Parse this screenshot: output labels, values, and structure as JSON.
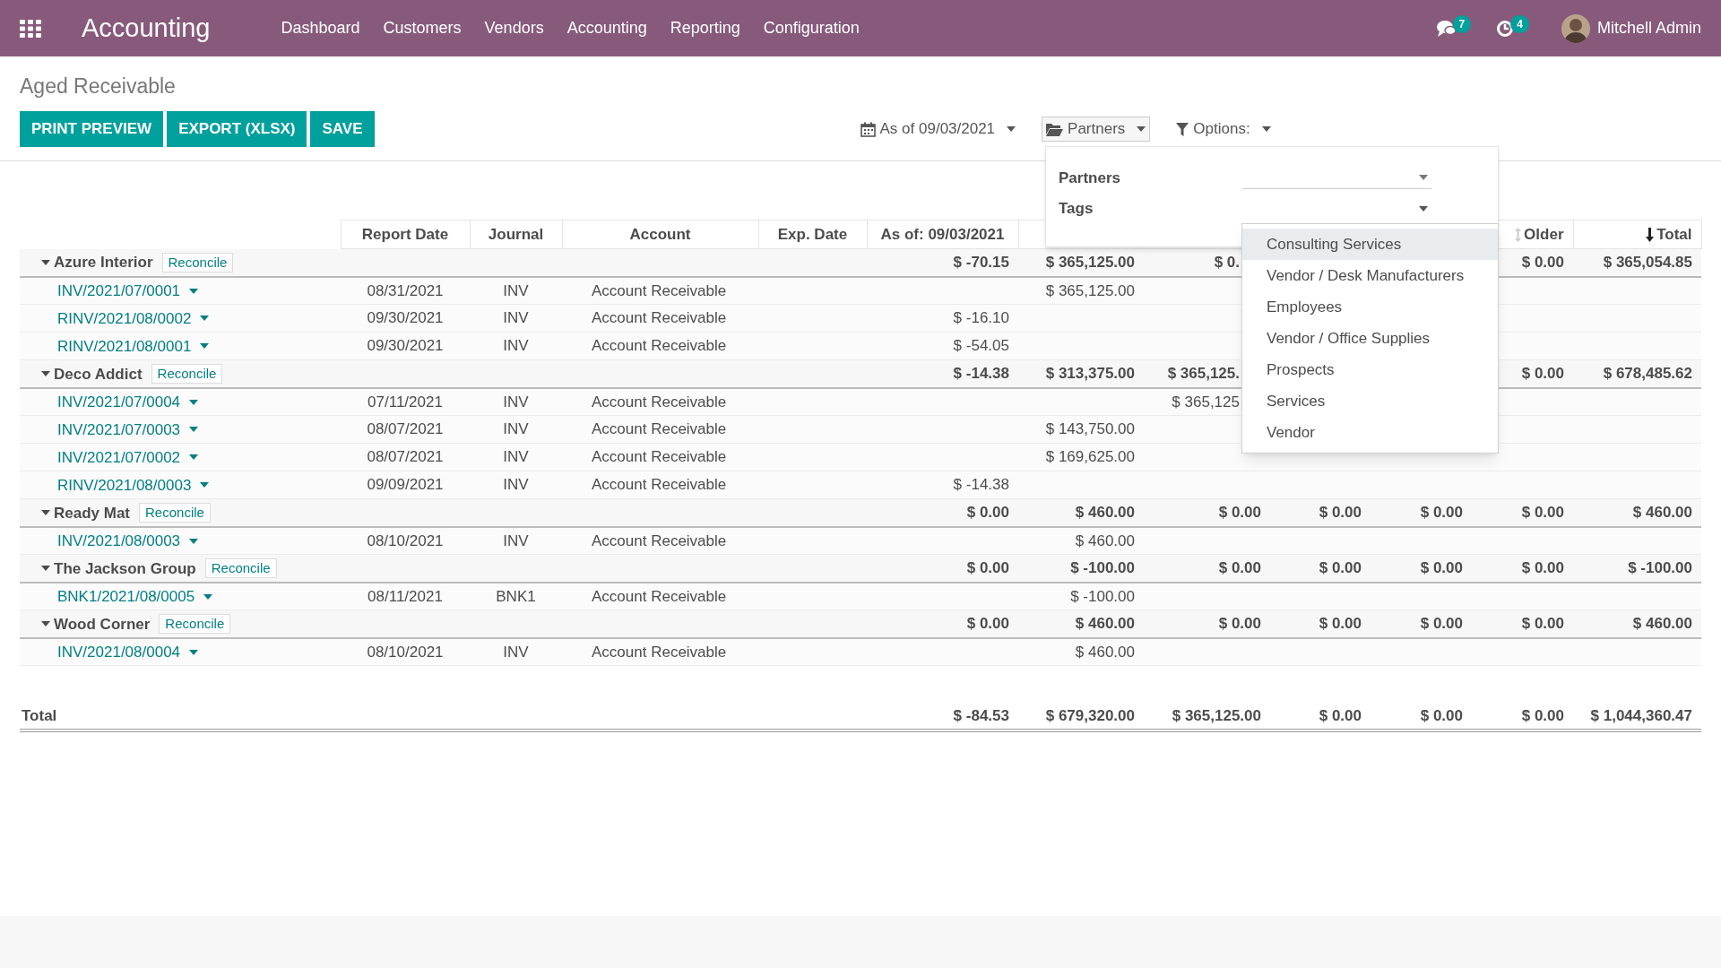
{
  "navbar": {
    "app_title": "Accounting",
    "menu": [
      "Dashboard",
      "Customers",
      "Vendors",
      "Accounting",
      "Reporting",
      "Configuration"
    ],
    "messages_count": "7",
    "activities_count": "4",
    "user": "Mitchell Admin"
  },
  "page_title": "Aged Receivable",
  "buttons": [
    "PRINT PREVIEW",
    "EXPORT (XLSX)",
    "SAVE"
  ],
  "filters": [
    {
      "kind": "date",
      "label": "As of 09/03/2021",
      "selected": false
    },
    {
      "kind": "partners",
      "label": "Partners",
      "selected": true
    },
    {
      "kind": "options",
      "label": "Options:",
      "selected": false
    }
  ],
  "partner_panel": {
    "fields": [
      {
        "label": "Partners",
        "expanded": false
      },
      {
        "label": "Tags",
        "expanded": true
      }
    ],
    "tags_menu": [
      {
        "label": "Consulting Services",
        "selected": true
      },
      {
        "label": "Vendor / Desk Manufacturers",
        "selected": false
      },
      {
        "label": "Employees",
        "selected": false
      },
      {
        "label": "Vendor / Office Supplies",
        "selected": false
      },
      {
        "label": "Prospects",
        "selected": false
      },
      {
        "label": "Services",
        "selected": false
      },
      {
        "label": "Vendor",
        "selected": false
      }
    ]
  },
  "table": {
    "headers_left": [
      {
        "kind": "plain",
        "label": "Report Date"
      },
      {
        "kind": "plain",
        "label": "Journal"
      },
      {
        "kind": "plain",
        "label": "Account"
      },
      {
        "kind": "plain",
        "label": "Exp. Date"
      },
      {
        "kind": "plain",
        "label": "As of: 09/03/2021"
      }
    ],
    "headers_right": [
      {
        "kind": "sortable",
        "label": "Older"
      },
      {
        "kind": "sorted",
        "label": "Total"
      }
    ],
    "rows": [
      {
        "kind": "partner",
        "label": "Azure Interior",
        "expanded": true,
        "action": "Reconcile",
        "cells": {
          "as_of": "$ -70.15",
          "column_7": "$ 365,125.00",
          "column_8_cut": "$ 0.",
          "older": "$ 0.00",
          "total": "$ 365,054.85"
        }
      },
      {
        "kind": "line",
        "label": "INV/2021/07/0001",
        "cells": {
          "report_date": "08/31/2021",
          "journal": "INV",
          "account": "Account Receivable",
          "column_7": "$ 365,125.00"
        }
      },
      {
        "kind": "line",
        "label": "RINV/2021/08/0002",
        "cells": {
          "report_date": "09/30/2021",
          "journal": "INV",
          "account": "Account Receivable",
          "as_of": "$ -16.10"
        }
      },
      {
        "kind": "line",
        "label": "RINV/2021/08/0001",
        "cells": {
          "report_date": "09/30/2021",
          "journal": "INV",
          "account": "Account Receivable",
          "as_of": "$ -54.05"
        }
      },
      {
        "kind": "partner",
        "label": "Deco Addict",
        "expanded": true,
        "action": "Reconcile",
        "cells": {
          "as_of": "$ -14.38",
          "column_7": "$ 313,375.00",
          "column_8_cut": "$ 365,125.",
          "older": "$ 0.00",
          "total": "$ 678,485.62"
        }
      },
      {
        "kind": "line",
        "label": "INV/2021/07/0004",
        "cells": {
          "report_date": "07/11/2021",
          "journal": "INV",
          "account": "Account Receivable",
          "column_8_cut": "$ 365,125"
        }
      },
      {
        "kind": "line",
        "label": "INV/2021/07/0003",
        "cells": {
          "report_date": "08/07/2021",
          "journal": "INV",
          "account": "Account Receivable",
          "column_7": "$ 143,750.00"
        }
      },
      {
        "kind": "line",
        "label": "INV/2021/07/0002",
        "cells": {
          "report_date": "08/07/2021",
          "journal": "INV",
          "account": "Account Receivable",
          "column_7": "$ 169,625.00"
        }
      },
      {
        "kind": "line",
        "label": "RINV/2021/08/0003",
        "cells": {
          "report_date": "09/09/2021",
          "journal": "INV",
          "account": "Account Receivable",
          "as_of": "$ -14.38"
        }
      },
      {
        "kind": "partner",
        "label": "Ready Mat",
        "expanded": true,
        "action": "Reconcile",
        "cells": {
          "as_of": "$ 0.00",
          "column_7": "$ 460.00",
          "column_8": "$ 0.00",
          "column_9": "$ 0.00",
          "column_10": "$ 0.00",
          "older": "$ 0.00",
          "total": "$ 460.00"
        }
      },
      {
        "kind": "line",
        "label": "INV/2021/08/0003",
        "cells": {
          "report_date": "08/10/2021",
          "journal": "INV",
          "account": "Account Receivable",
          "column_7": "$ 460.00"
        }
      },
      {
        "kind": "partner",
        "label": "The Jackson Group",
        "expanded": true,
        "action": "Reconcile",
        "cells": {
          "as_of": "$ 0.00",
          "column_7": "$ -100.00",
          "column_8": "$ 0.00",
          "column_9": "$ 0.00",
          "column_10": "$ 0.00",
          "older": "$ 0.00",
          "total": "$ -100.00"
        }
      },
      {
        "kind": "line",
        "label": "BNK1/2021/08/0005",
        "cells": {
          "report_date": "08/11/2021",
          "journal": "BNK1",
          "account": "Account Receivable",
          "column_7": "$ -100.00"
        }
      },
      {
        "kind": "partner",
        "label": "Wood Corner",
        "expanded": true,
        "action": "Reconcile",
        "cells": {
          "as_of": "$ 0.00",
          "column_7": "$ 460.00",
          "column_8": "$ 0.00",
          "column_9": "$ 0.00",
          "column_10": "$ 0.00",
          "older": "$ 0.00",
          "total": "$ 460.00"
        }
      },
      {
        "kind": "line",
        "label": "INV/2021/08/0004",
        "cells": {
          "report_date": "08/10/2021",
          "journal": "INV",
          "account": "Account Receivable",
          "column_7": "$ 460.00"
        }
      }
    ],
    "total": {
      "label": "Total",
      "cells": {
        "as_of": "$ -84.53",
        "column_7": "$ 679,320.00",
        "column_8": "$ 365,125.00",
        "column_9": "$ 0.00",
        "column_10": "$ 0.00",
        "older": "$ 0.00",
        "total": "$ 1,044,360.47"
      }
    }
  }
}
